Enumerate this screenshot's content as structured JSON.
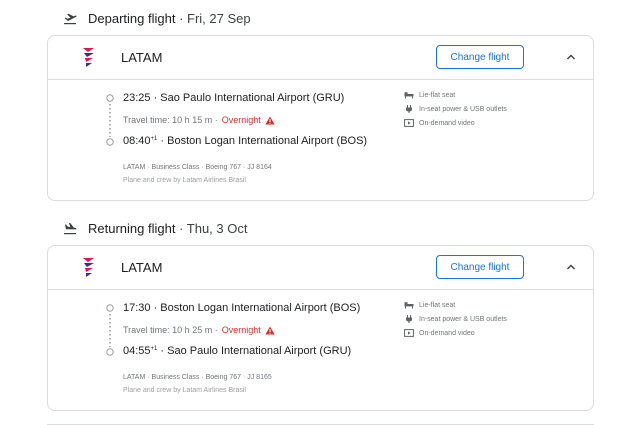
{
  "departing": {
    "label": "Departing flight",
    "date": " · Fri, 27 Sep",
    "airline": "LATAM",
    "change_label": "Change flight",
    "depart_time": "23:25",
    "depart_airport": " · Sao Paulo International Airport (GRU)",
    "travel_time": "Travel time: 10 h 15 m ·",
    "overnight": "Overnight",
    "arrive_time": "08:40",
    "arrive_offset": "+1",
    "arrive_airport": " · Boston Logan International Airport (BOS)",
    "details": "LATAM · Business Class · Boeing 767 · JJ 8164",
    "operated": "Plane and crew by Latam Airlines Brasil",
    "amenities": [
      "Lie-flat seat",
      "In-seat power & USB outlets",
      "On-demand video"
    ]
  },
  "returning": {
    "label": "Returning flight",
    "date": " · Thu, 3 Oct",
    "airline": "LATAM",
    "change_label": "Change flight",
    "depart_time": "17:30",
    "depart_airport": " · Boston Logan International Airport (BOS)",
    "travel_time": "Travel time: 10 h 25 m ·",
    "overnight": "Overnight",
    "arrive_time": "04:55",
    "arrive_offset": "+1",
    "arrive_airport": " · Sao Paulo International Airport (GRU)",
    "details": "LATAM · Business Class · Boeing 767 · JJ 8165",
    "operated": "Plane and crew by Latam Airlines Brasil",
    "amenities": [
      "Lie-flat seat",
      "In-seat power & USB outlets",
      "On-demand video"
    ]
  },
  "colors": {
    "accent": "#1a73e8",
    "warning": "#d93025",
    "border": "#dadce0",
    "muted": "#70757a"
  },
  "icons": [
    "takeoff-icon",
    "landing-icon",
    "latam-logo",
    "chevron-up-icon",
    "warning-icon",
    "seat-icon",
    "power-icon",
    "video-icon"
  ]
}
